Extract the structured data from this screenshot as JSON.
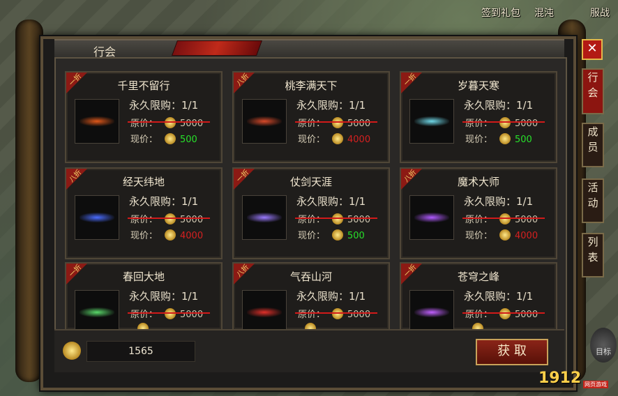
{
  "hud": {
    "sign_in_gift": "签到礼包",
    "chaos_label": "混沌",
    "server_label": "服战"
  },
  "window": {
    "title": "行会",
    "close_icon": "close-icon"
  },
  "side_tabs": [
    "行会",
    "成员",
    "活动",
    "列表"
  ],
  "cards": [
    {
      "name": "千里不留行",
      "badge": "一折",
      "limit": "永久限购：1/1",
      "orig_label": "原价：",
      "orig_price": "5000",
      "now_label": "现价：",
      "now_price": "500",
      "price_color": "green",
      "glow": "#e0581a"
    },
    {
      "name": "桃李满天下",
      "badge": "八折",
      "limit": "永久限购：1/1",
      "orig_label": "原价：",
      "orig_price": "5000",
      "now_label": "现价：",
      "now_price": "4000",
      "price_color": "red",
      "glow": "#d84a2a"
    },
    {
      "name": "岁暮天寒",
      "badge": "一折",
      "limit": "永久限购：1/1",
      "orig_label": "原价：",
      "orig_price": "5000",
      "now_label": "现价：",
      "now_price": "500",
      "price_color": "green",
      "glow": "#6fd8e8"
    },
    {
      "name": "经天纬地",
      "badge": "八折",
      "limit": "永久限购：1/1",
      "orig_label": "原价：",
      "orig_price": "5000",
      "now_label": "现价：",
      "now_price": "4000",
      "price_color": "red",
      "glow": "#4a6cff"
    },
    {
      "name": "仗剑天涯",
      "badge": "一折",
      "limit": "永久限购：1/1",
      "orig_label": "原价：",
      "orig_price": "5000",
      "now_label": "现价：",
      "now_price": "500",
      "price_color": "green",
      "glow": "#9a7aff"
    },
    {
      "name": "魔术大师",
      "badge": "八折",
      "limit": "永久限购：1/1",
      "orig_label": "原价：",
      "orig_price": "5000",
      "now_label": "现价：",
      "now_price": "4000",
      "price_color": "red",
      "glow": "#b05aff"
    },
    {
      "name": "春回大地",
      "badge": "一折",
      "limit": "永久限购：1/1",
      "orig_label": "原价：",
      "orig_price": "5000",
      "now_label": "",
      "now_price": "",
      "price_color": "green",
      "glow": "#5ad86a"
    },
    {
      "name": "气吞山河",
      "badge": "八折",
      "limit": "永久限购：1/1",
      "orig_label": "原价：",
      "orig_price": "5000",
      "now_label": "",
      "now_price": "",
      "price_color": "red",
      "glow": "#e0302a"
    },
    {
      "name": "苍穹之峰",
      "badge": "一折",
      "limit": "永久限购：1/1",
      "orig_label": "原价：",
      "orig_price": "5000",
      "now_label": "",
      "now_price": "",
      "price_color": "green",
      "glow": "#c060ff"
    }
  ],
  "footer": {
    "currency_amount": "1565",
    "get_button": "获 取"
  },
  "branding": {
    "logo": "1912",
    "logo_badge": "网页游戏",
    "right_icon_label": "目标"
  },
  "colors": {
    "green_price": "#27e02a",
    "red_price": "#d52020",
    "accent_red": "#8c1510",
    "gold": "#e4b84a"
  }
}
